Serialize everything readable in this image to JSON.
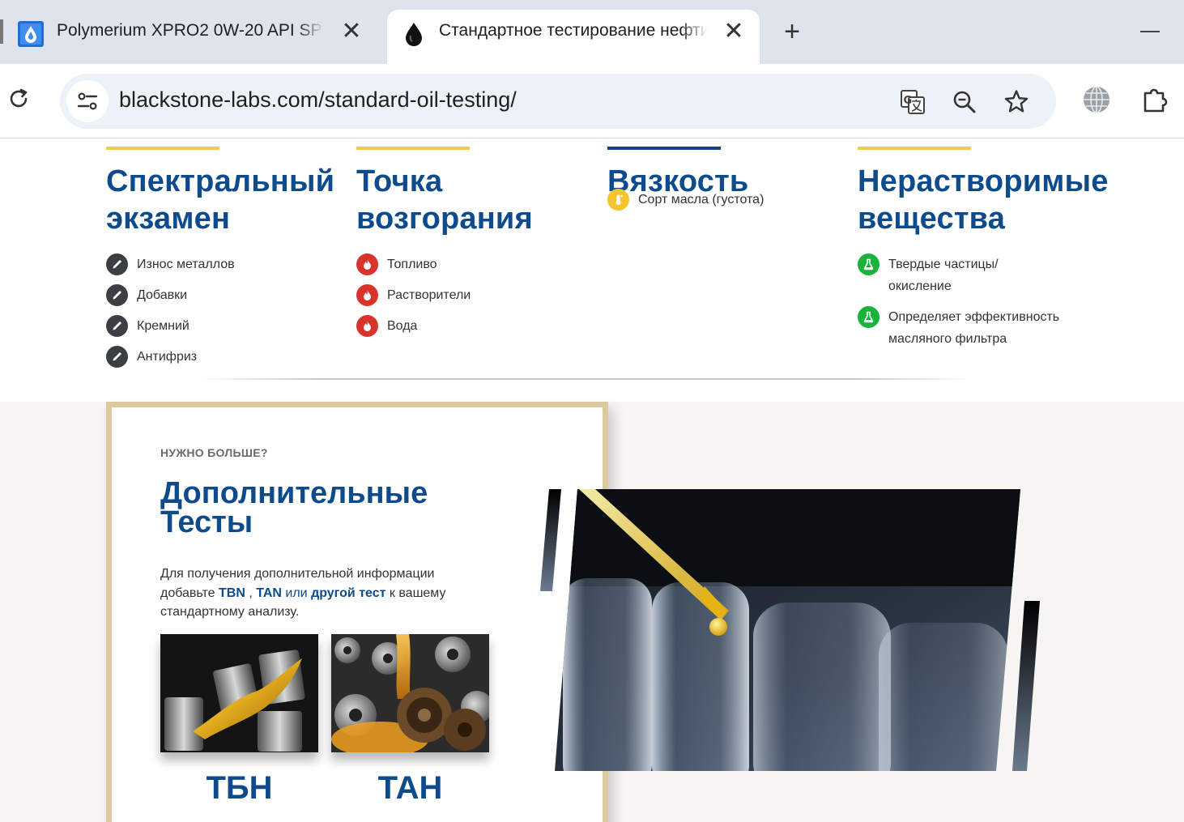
{
  "browser": {
    "tabs": [
      {
        "title": "Polymerium XPRO2 0W-20 API SP",
        "active": false
      },
      {
        "title": "Стандартное тестирование нефти",
        "active": true
      }
    ],
    "close_glyph": "✕",
    "new_tab_glyph": "+",
    "url": "blackstone-labs.com/standard-oil-testing/",
    "icons": [
      "reload-icon",
      "site-info-icon",
      "translate-icon",
      "zoom-icon",
      "bookmark-star-icon",
      "globe-icon",
      "extensions-icon"
    ]
  },
  "colors": {
    "brand_blue": "#0e4b8c",
    "accent_yellow": "#f2c94c",
    "accent_navy": "#12437f",
    "bullet_dark": "#3b3f44",
    "bullet_red": "#d9342b",
    "bullet_yellow": "#f4c430",
    "bullet_green": "#17b33a",
    "card_border": "#dcc9a0"
  },
  "columns": [
    {
      "heading": "Спектральный экзамен",
      "bar_color": "#f2c94c",
      "icon": "dropper-icon",
      "items": [
        "Износ металлов",
        "Добавки",
        "Кремний",
        "Антифриз"
      ]
    },
    {
      "heading": "Точка возгорания",
      "bar_color": "#f2c94c",
      "icon": "flame-icon",
      "items": [
        "Топливо",
        "Растворители",
        "Вода"
      ]
    },
    {
      "heading": "Вязкость",
      "bar_color": "#12437f",
      "icon": "thermometer-icon",
      "items": [
        "Сорт масла (густота)"
      ]
    },
    {
      "heading": "Нерастворимые вещества",
      "bar_color": "#f2c94c",
      "icon": "flask-icon",
      "items": [
        "Твердые частицы/ окисление",
        "Определяет эффективность масляного фильтра"
      ]
    }
  ],
  "more": {
    "kicker": "НУЖНО БОЛЬШЕ?",
    "title_line1": "Дополнительные",
    "title_line2": "Тесты",
    "text_before": "Для получения дополнительной информации добавьте ",
    "tbn": "TBN",
    "comma": " , ",
    "tan": "TAN",
    "or": " или ",
    "other": "другой тест",
    "text_after": " к вашему стандартному анализу.",
    "tests": [
      {
        "label": "ТБН"
      },
      {
        "label": "ТАН"
      }
    ]
  }
}
